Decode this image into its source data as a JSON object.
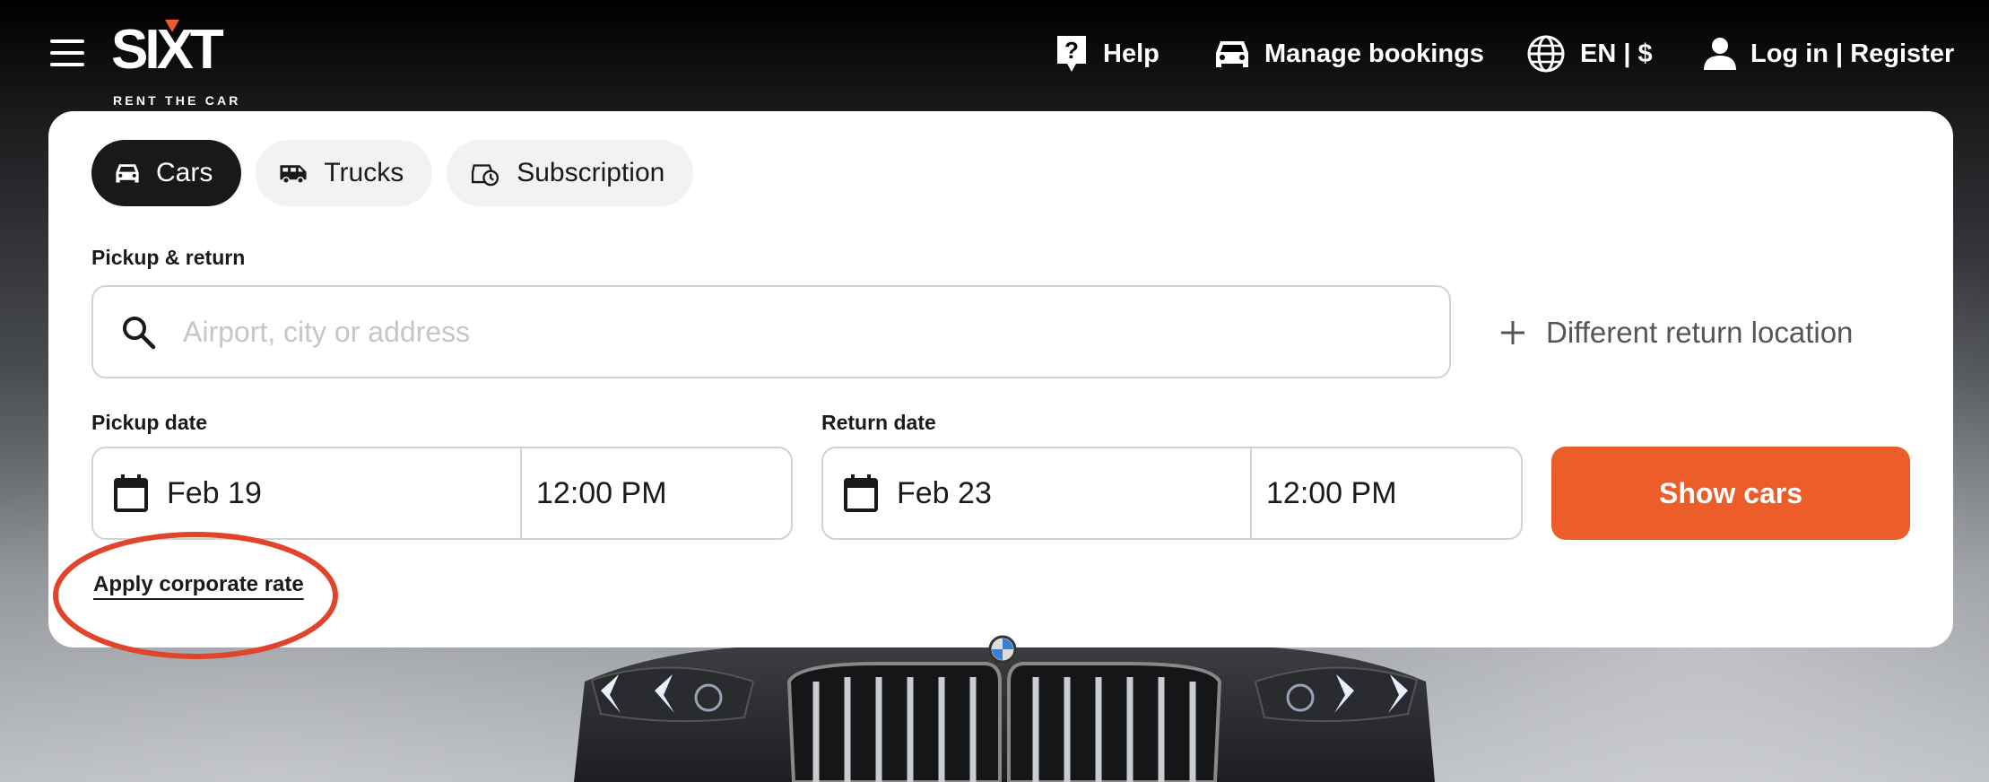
{
  "header": {
    "logo_wordmark": "SIXT",
    "logo_tagline": "RENT THE CAR",
    "nav": {
      "help": "Help",
      "manage_bookings": "Manage bookings",
      "language_currency": "EN | $",
      "login": "Log in | Register"
    }
  },
  "booking": {
    "tabs": [
      {
        "label": "Cars",
        "active": true
      },
      {
        "label": "Trucks",
        "active": false
      },
      {
        "label": "Subscription",
        "active": false
      }
    ],
    "pickup_return_label": "Pickup & return",
    "search_placeholder": "Airport, city or address",
    "different_return": "Different return location",
    "pickup": {
      "label": "Pickup date",
      "date": "Feb 19",
      "time": "12:00 PM"
    },
    "return": {
      "label": "Return date",
      "date": "Feb 23",
      "time": "12:00 PM"
    },
    "submit_label": "Show cars",
    "corporate_link": "Apply corporate rate"
  },
  "colors": {
    "accent": "#ec5d2a",
    "active_tab": "#191919",
    "annotation_circle": "#e0442b"
  }
}
